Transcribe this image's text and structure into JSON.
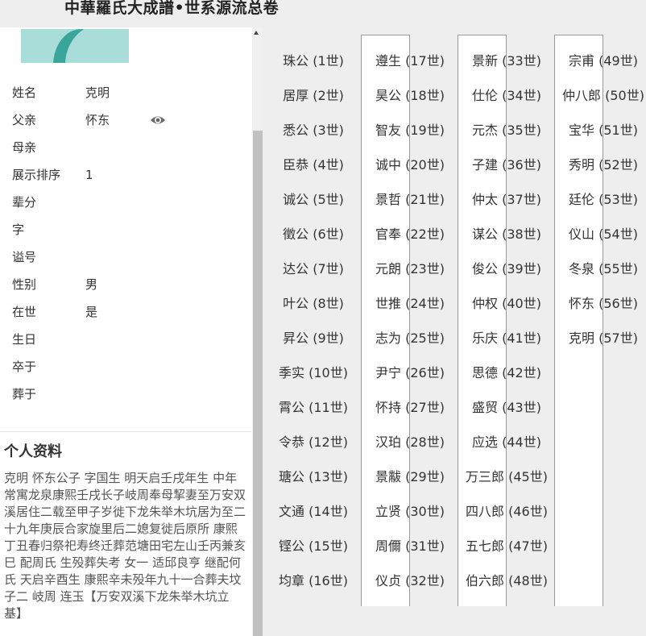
{
  "header": {
    "title": "中華羅氏大成譜•世系源流总卷"
  },
  "person": {
    "fields": [
      {
        "label": "姓名",
        "value": "克明"
      },
      {
        "label": "父亲",
        "value": "怀东"
      },
      {
        "label": "母亲",
        "value": ""
      },
      {
        "label": "展示排序",
        "value": "1"
      },
      {
        "label": "辈分",
        "value": ""
      },
      {
        "label": "字",
        "value": ""
      },
      {
        "label": "谥号",
        "value": ""
      },
      {
        "label": "性别",
        "value": "男"
      },
      {
        "label": "在世",
        "value": "是"
      },
      {
        "label": "生日",
        "value": ""
      },
      {
        "label": "卒于",
        "value": ""
      },
      {
        "label": "葬于",
        "value": ""
      }
    ],
    "eye_icon": "eye-icon"
  },
  "profile": {
    "title": "个人资料",
    "text": "克明 怀东公子 字国生 明天启壬戌年生 中年常寓龙泉康熙壬戌长子岐周奉母挈妻至万安双溪居住二载至甲子岁徙下龙朱举木坑居为至二十九年庚辰合家旋里后二媳复徙后原所 康熙丁丑春归祭祀寿终迁葬范塘田宅左山壬丙兼亥巳 配周氏 生殁葬失考 女一 适邱良亨 继配何氏 天启辛酉生 康熙辛未殁年九十一合葬夫坟 子二 岐周 连玉【万安双溪下龙朱举木坑立基】"
  },
  "generations": {
    "columns": [
      [
        "珠公 (1世)",
        "居厚 (2世)",
        "悉公 (3世)",
        "臣恭 (4世)",
        "诚公 (5世)",
        "徵公 (6世)",
        "达公 (7世)",
        "叶公 (8世)",
        "昇公 (9世)",
        "季实 (10世)",
        "霄公 (11世)",
        "令恭 (12世)",
        "瑭公 (13世)",
        "文通 (14世)",
        "铿公 (15世)",
        "均章 (16世)"
      ],
      [
        "遵生 (17世)",
        "昊公 (18世)",
        "智友 (19世)",
        "诚中 (20世)",
        "景哲 (21世)",
        "官奉 (22世)",
        "元朗 (23世)",
        "世推 (24世)",
        "志为 (25世)",
        "尹宁 (26世)",
        "怀持 (27世)",
        "汉珀 (28世)",
        "景黻 (29世)",
        "立贤 (30世)",
        "周儞 (31世)",
        "仪贞 (32世)"
      ],
      [
        "景新 (33世)",
        "仕伦 (34世)",
        "元杰 (35世)",
        "子建 (36世)",
        "仲太 (37世)",
        "谋公 (38世)",
        "俊公 (39世)",
        "仲权 (40世)",
        "乐庆 (41世)",
        "思德 (42世)",
        "盛贸 (43世)",
        "应选 (44世)",
        "万三郎 (45世)",
        "四八郎 (46世)",
        "五七郎 (47世)",
        "伯六郎 (48世)"
      ],
      [
        "宗甫 (49世)",
        "仲八郎 (50世)",
        "宝华 (51世)",
        "秀明 (52世)",
        "廷伦 (53世)",
        "仪山 (54世)",
        "冬泉 (55世)",
        "怀东 (56世)",
        "克明 (57世)"
      ]
    ]
  }
}
